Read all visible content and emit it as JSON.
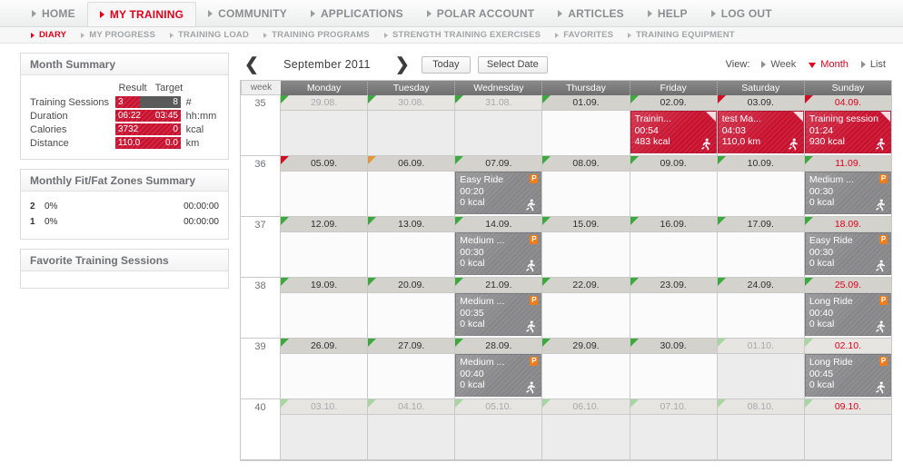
{
  "topnav": {
    "items": [
      {
        "label": "HOME",
        "active": false
      },
      {
        "label": "MY TRAINING",
        "active": true
      },
      {
        "label": "COMMUNITY",
        "active": false
      },
      {
        "label": "APPLICATIONS",
        "active": false
      },
      {
        "label": "POLAR ACCOUNT",
        "active": false
      },
      {
        "label": "ARTICLES",
        "active": false
      },
      {
        "label": "HELP",
        "active": false
      },
      {
        "label": "LOG OUT",
        "active": false
      }
    ]
  },
  "subnav": {
    "items": [
      {
        "label": "DIARY",
        "active": true
      },
      {
        "label": "MY PROGRESS",
        "active": false
      },
      {
        "label": "TRAINING LOAD",
        "active": false
      },
      {
        "label": "TRAINING PROGRAMS",
        "active": false
      },
      {
        "label": "STRENGTH TRAINING EXERCISES",
        "active": false
      },
      {
        "label": "FAVORITES",
        "active": false
      },
      {
        "label": "TRAINING EQUIPMENT",
        "active": false
      }
    ]
  },
  "sidebar": {
    "month_summary": {
      "title": "Month Summary",
      "col_result": "Result",
      "col_target": "Target",
      "rows": [
        {
          "label": "Training Sessions",
          "result": "3",
          "target": "8",
          "unit": "#",
          "fill_pct": 37
        },
        {
          "label": "Duration",
          "result": "06:22",
          "target": "03:45",
          "unit": "hh:mm",
          "fill_pct": 100
        },
        {
          "label": "Calories",
          "result": "3732",
          "target": "0",
          "unit": "kcal",
          "fill_pct": 100
        },
        {
          "label": "Distance",
          "result": "110.0",
          "target": "0.0",
          "unit": "km",
          "fill_pct": 100
        }
      ]
    },
    "zones": {
      "title": "Monthly Fit/Fat Zones Summary",
      "rows": [
        {
          "zone": "2",
          "pct": "0%",
          "time": "00:00:00"
        },
        {
          "zone": "1",
          "pct": "0%",
          "time": "00:00:00"
        }
      ]
    },
    "favorites": {
      "title": "Favorite Training Sessions"
    }
  },
  "calendar": {
    "prev_label": "❮",
    "next_label": "❯",
    "month": "September 2011",
    "today_label": "Today",
    "select_date_label": "Select Date",
    "view_label": "View:",
    "views": [
      {
        "label": "Week",
        "active": false
      },
      {
        "label": "Month",
        "active": true
      },
      {
        "label": "List",
        "active": false
      }
    ],
    "week_header": "week",
    "days": [
      "Monday",
      "Tuesday",
      "Wednesday",
      "Thursday",
      "Friday",
      "Saturday",
      "Sunday"
    ],
    "weeks": [
      {
        "week": "35",
        "cells": [
          {
            "date": "29.08.",
            "out": true,
            "sunday": false,
            "flag": "green",
            "session": null
          },
          {
            "date": "30.08.",
            "out": true,
            "sunday": false,
            "flag": "green",
            "session": null
          },
          {
            "date": "31.08.",
            "out": true,
            "sunday": false,
            "flag": "green",
            "session": null
          },
          {
            "date": "01.09.",
            "out": false,
            "sunday": false,
            "flag": "green",
            "session": null
          },
          {
            "date": "02.09.",
            "out": false,
            "sunday": false,
            "flag": "green",
            "session": {
              "style": "red",
              "title": "Trainin...",
              "duration": "00:54",
              "metric": "483 kcal",
              "program": false
            }
          },
          {
            "date": "03.09.",
            "out": false,
            "sunday": false,
            "flag": "red",
            "session": {
              "style": "red",
              "title": "test Ma...",
              "duration": "04:03",
              "metric": "110,0 km",
              "program": false
            }
          },
          {
            "date": "04.09.",
            "out": false,
            "sunday": true,
            "flag": "red",
            "session": {
              "style": "red",
              "title": "Training session",
              "duration": "01:24",
              "metric": "930 kcal",
              "program": false
            }
          }
        ]
      },
      {
        "week": "36",
        "cells": [
          {
            "date": "05.09.",
            "out": false,
            "sunday": false,
            "flag": "red",
            "session": null
          },
          {
            "date": "06.09.",
            "out": false,
            "sunday": false,
            "flag": "orange",
            "session": null
          },
          {
            "date": "07.09.",
            "out": false,
            "sunday": false,
            "flag": "green",
            "session": {
              "style": "gray",
              "title": "Easy Ride",
              "duration": "00:20",
              "metric": "0 kcal",
              "program": true
            }
          },
          {
            "date": "08.09.",
            "out": false,
            "sunday": false,
            "flag": "green",
            "session": null
          },
          {
            "date": "09.09.",
            "out": false,
            "sunday": false,
            "flag": "green",
            "session": null
          },
          {
            "date": "10.09.",
            "out": false,
            "sunday": false,
            "flag": "green",
            "session": null
          },
          {
            "date": "11.09.",
            "out": false,
            "sunday": true,
            "flag": "green",
            "session": {
              "style": "gray",
              "title": "Medium ...",
              "duration": "00:30",
              "metric": "0 kcal",
              "program": true
            }
          }
        ]
      },
      {
        "week": "37",
        "cells": [
          {
            "date": "12.09.",
            "out": false,
            "sunday": false,
            "flag": "green",
            "session": null
          },
          {
            "date": "13.09.",
            "out": false,
            "sunday": false,
            "flag": "green",
            "session": null
          },
          {
            "date": "14.09.",
            "out": false,
            "sunday": false,
            "flag": "green",
            "session": {
              "style": "gray",
              "title": "Medium ...",
              "duration": "00:30",
              "metric": "0 kcal",
              "program": true
            }
          },
          {
            "date": "15.09.",
            "out": false,
            "sunday": false,
            "flag": "green",
            "session": null
          },
          {
            "date": "16.09.",
            "out": false,
            "sunday": false,
            "flag": "green",
            "session": null
          },
          {
            "date": "17.09.",
            "out": false,
            "sunday": false,
            "flag": "green",
            "session": null
          },
          {
            "date": "18.09.",
            "out": false,
            "sunday": true,
            "flag": "green",
            "session": {
              "style": "gray",
              "title": "Easy Ride",
              "duration": "00:30",
              "metric": "0 kcal",
              "program": true
            }
          }
        ]
      },
      {
        "week": "38",
        "cells": [
          {
            "date": "19.09.",
            "out": false,
            "sunday": false,
            "flag": "green",
            "session": null
          },
          {
            "date": "20.09.",
            "out": false,
            "sunday": false,
            "flag": "green",
            "session": null
          },
          {
            "date": "21.09.",
            "out": false,
            "sunday": false,
            "flag": "green",
            "session": {
              "style": "gray",
              "title": "Medium ...",
              "duration": "00:35",
              "metric": "0 kcal",
              "program": true
            }
          },
          {
            "date": "22.09.",
            "out": false,
            "sunday": false,
            "flag": "green",
            "session": null
          },
          {
            "date": "23.09.",
            "out": false,
            "sunday": false,
            "flag": "green",
            "session": null
          },
          {
            "date": "24.09.",
            "out": false,
            "sunday": false,
            "flag": "green",
            "session": null
          },
          {
            "date": "25.09.",
            "out": false,
            "sunday": true,
            "flag": "green",
            "session": {
              "style": "gray",
              "title": "Long Ride",
              "duration": "00:40",
              "metric": "0 kcal",
              "program": true
            }
          }
        ]
      },
      {
        "week": "39",
        "cells": [
          {
            "date": "26.09.",
            "out": false,
            "sunday": false,
            "flag": "green",
            "session": null
          },
          {
            "date": "27.09.",
            "out": false,
            "sunday": false,
            "flag": "green",
            "session": null
          },
          {
            "date": "28.09.",
            "out": false,
            "sunday": false,
            "flag": "green",
            "session": {
              "style": "gray",
              "title": "Medium ...",
              "duration": "00:40",
              "metric": "0 kcal",
              "program": true
            }
          },
          {
            "date": "29.09.",
            "out": false,
            "sunday": false,
            "flag": "green",
            "session": null
          },
          {
            "date": "30.09.",
            "out": false,
            "sunday": false,
            "flag": "green",
            "session": null
          },
          {
            "date": "01.10.",
            "out": true,
            "sunday": false,
            "flag": "pale",
            "session": null
          },
          {
            "date": "02.10.",
            "out": true,
            "sunday": true,
            "flag": "pale",
            "session": {
              "style": "gray",
              "title": "Long Ride",
              "duration": "00:45",
              "metric": "0 kcal",
              "program": true
            }
          }
        ]
      },
      {
        "week": "40",
        "cells": [
          {
            "date": "03.10.",
            "out": true,
            "sunday": false,
            "flag": "pale",
            "session": null
          },
          {
            "date": "04.10.",
            "out": true,
            "sunday": false,
            "flag": "pale",
            "session": null
          },
          {
            "date": "05.10.",
            "out": true,
            "sunday": false,
            "flag": "pale",
            "session": null
          },
          {
            "date": "06.10.",
            "out": true,
            "sunday": false,
            "flag": "pale",
            "session": null
          },
          {
            "date": "07.10.",
            "out": true,
            "sunday": false,
            "flag": "pale",
            "session": null
          },
          {
            "date": "08.10.",
            "out": true,
            "sunday": false,
            "flag": "pale",
            "session": null
          },
          {
            "date": "09.10.",
            "out": true,
            "sunday": true,
            "flag": "pale",
            "session": null
          }
        ]
      }
    ]
  },
  "colors": {
    "accent_red": "#e2001a",
    "bar_red": "#c8102e",
    "program_orange": "#ef7d1a",
    "flag_green": "#3da83d",
    "session_gray": "#86868a"
  },
  "icons": {
    "program_badge": "P"
  }
}
